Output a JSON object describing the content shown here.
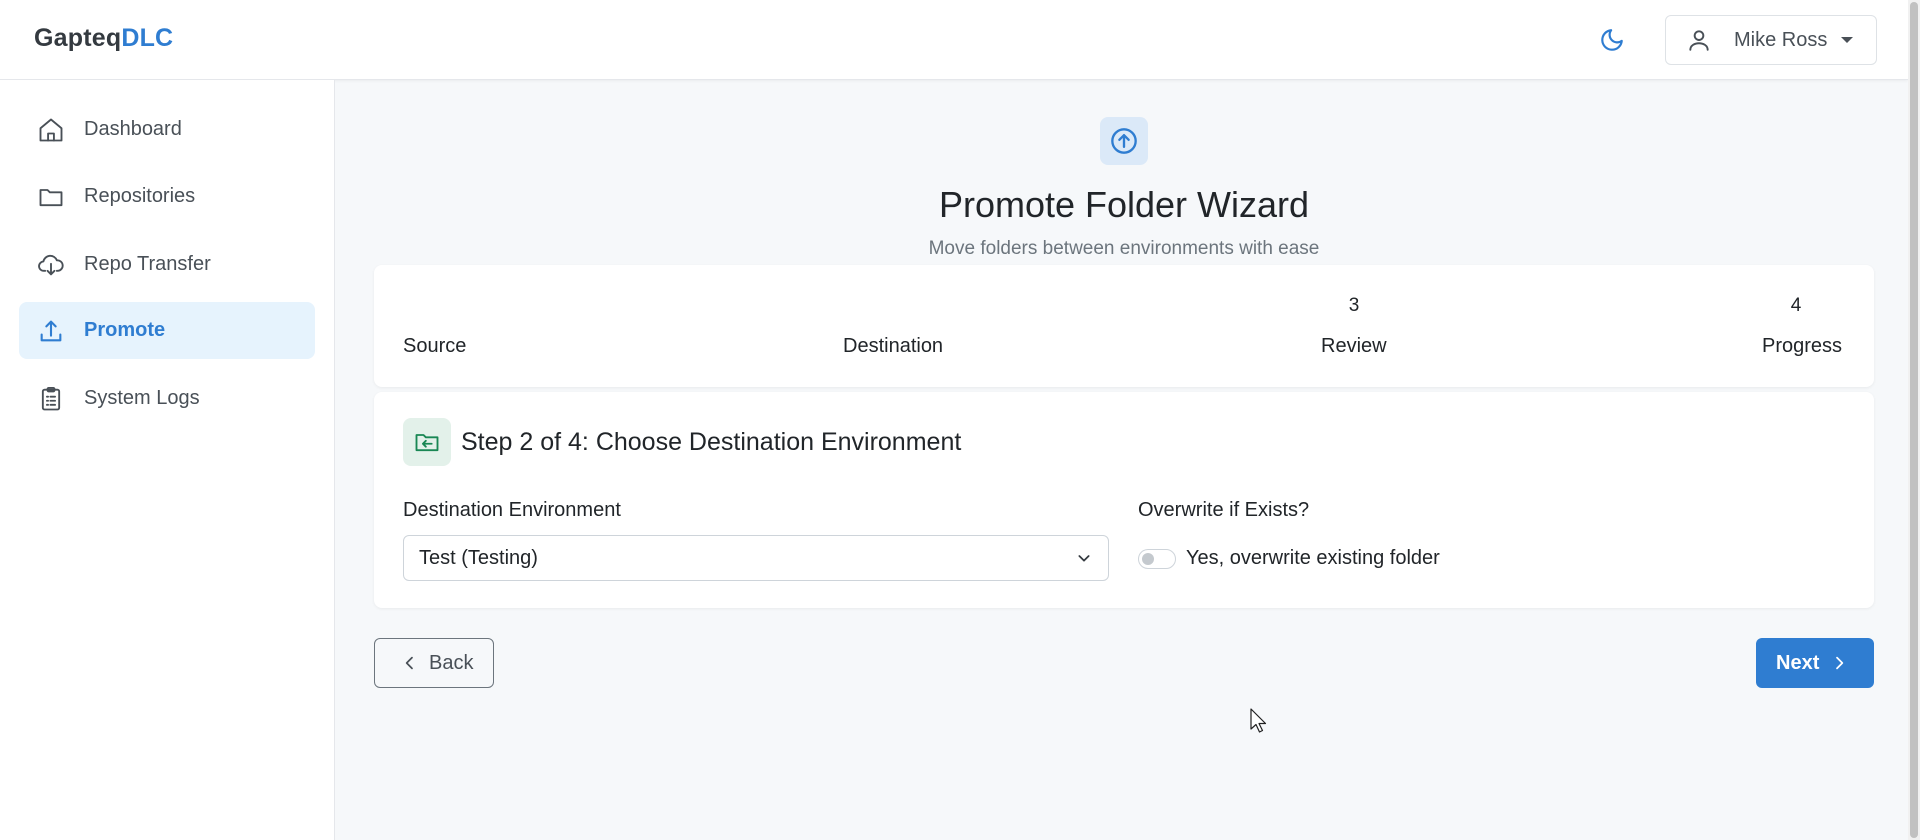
{
  "header": {
    "brand_main": "Gapteq",
    "brand_accent": "DLC",
    "theme_icon": "moon-icon",
    "user": {
      "name": "Mike Ross",
      "icon": "user-icon"
    }
  },
  "sidebar": {
    "items": [
      {
        "label": "Dashboard",
        "icon": "home-icon",
        "active": false
      },
      {
        "label": "Repositories",
        "icon": "folder-icon",
        "active": false
      },
      {
        "label": "Repo Transfer",
        "icon": "cloud-download-icon",
        "active": false
      },
      {
        "label": "Promote",
        "icon": "upload-icon",
        "active": true
      },
      {
        "label": "System Logs",
        "icon": "clipboard-icon",
        "active": false
      }
    ]
  },
  "page": {
    "icon": "arrow-up-circle-icon",
    "title": "Promote Folder Wizard",
    "subtitle": "Move folders between environments with ease"
  },
  "steps": [
    {
      "number": "",
      "label": "Source"
    },
    {
      "number": "",
      "label": "Destination"
    },
    {
      "number": "3",
      "label": "Review"
    },
    {
      "number": "4",
      "label": "Progress"
    }
  ],
  "form": {
    "step_title": "Step 2 of 4: Choose Destination Environment",
    "step_icon": "folder-arrow-icon",
    "destination_label": "Destination Environment",
    "destination_value": "Test (Testing)",
    "overwrite_label": "Overwrite if Exists?",
    "overwrite_toggle_label": "Yes, overwrite existing folder",
    "overwrite_checked": false
  },
  "actions": {
    "back_label": "Back",
    "next_label": "Next"
  },
  "colors": {
    "accent": "#2f7dd1",
    "active_bg": "#e6f3fd",
    "success_icon": "#198754"
  }
}
